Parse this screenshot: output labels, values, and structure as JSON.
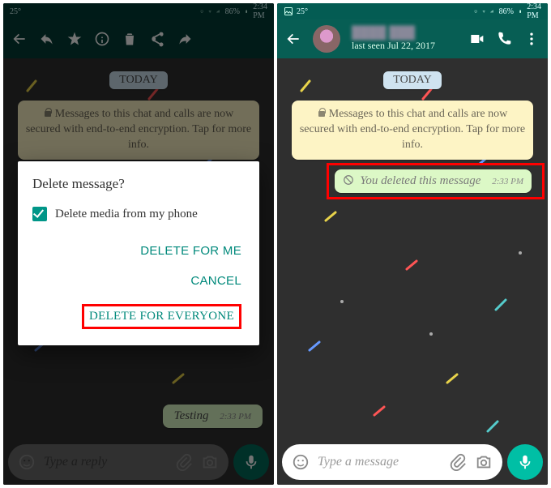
{
  "status": {
    "temp_left": "25°",
    "temp_right": "25°",
    "signal": "86%",
    "time": "2:34 PM"
  },
  "appbar_right": {
    "last_seen": "last seen Jul 22, 2017",
    "contact_name": ""
  },
  "day_label": "TODAY",
  "encryption_notice": "Messages to this chat and calls are now secured with end-to-end encryption. Tap for more info.",
  "deleted_msg": {
    "text": "You deleted this message",
    "time": "2:33 PM"
  },
  "test_msg": {
    "text": "Testing",
    "time": "2:33 PM"
  },
  "input_left_placeholder": "Type a reply",
  "input_right_placeholder": "Type a message",
  "dialog": {
    "title": "Delete message?",
    "checkbox_label": "Delete media from my phone",
    "btn_me": "DELETE FOR ME",
    "btn_cancel": "CANCEL",
    "btn_everyone": "DELETE FOR EVERYONE"
  }
}
